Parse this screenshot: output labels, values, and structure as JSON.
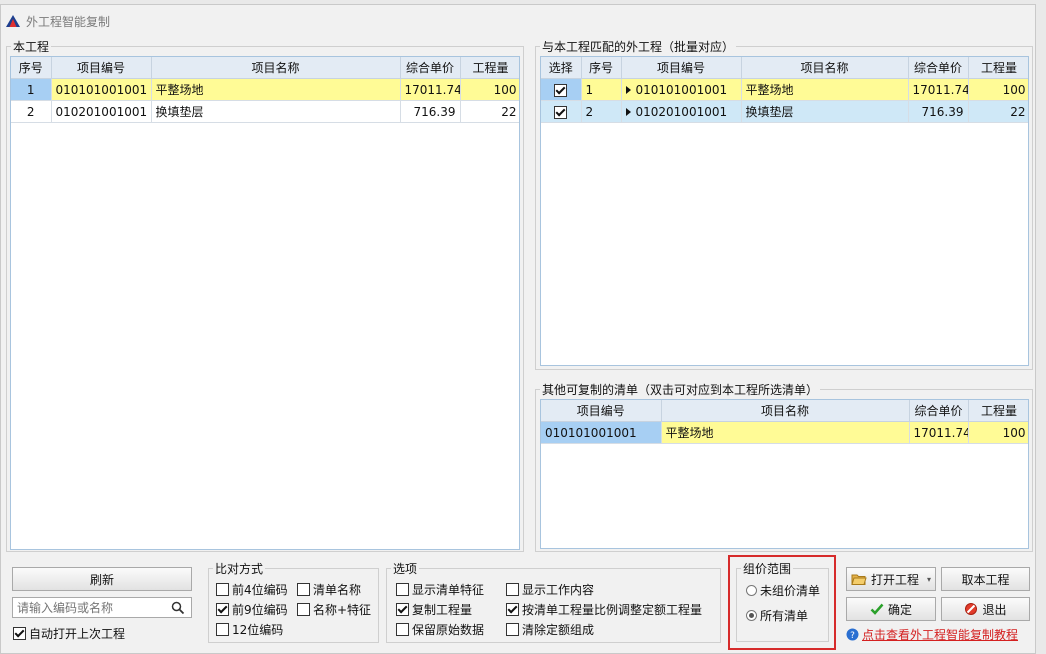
{
  "window": {
    "title": "外工程智能复制"
  },
  "left_panel": {
    "title": "本工程",
    "columns": [
      "序号",
      "项目编号",
      "项目名称",
      "综合单价",
      "工程量"
    ],
    "rows": [
      {
        "idx": "1",
        "code": "010101001001",
        "name": "平整场地",
        "price": "17011.74",
        "qty": "100"
      },
      {
        "idx": "2",
        "code": "010201001001",
        "name": "换填垫层",
        "price": "716.39",
        "qty": "22"
      }
    ]
  },
  "match_panel": {
    "title": "与本工程匹配的外工程（批量对应）",
    "columns": [
      "选择",
      "序号",
      "项目编号",
      "项目名称",
      "综合单价",
      "工程量"
    ],
    "rows": [
      {
        "checked": true,
        "idx": "1",
        "code": "010101001001",
        "name": "平整场地",
        "price": "17011.74",
        "qty": "100"
      },
      {
        "checked": true,
        "idx": "2",
        "code": "010201001001",
        "name": "换填垫层",
        "price": "716.39",
        "qty": "22"
      }
    ]
  },
  "other_panel": {
    "title": "其他可复制的清单（双击可对应到本工程所选清单）",
    "columns": [
      "项目编号",
      "项目名称",
      "综合单价",
      "工程量"
    ],
    "rows": [
      {
        "code": "010101001001",
        "name": "平整场地",
        "price": "17011.74",
        "qty": "100"
      }
    ]
  },
  "bottom": {
    "refresh_label": "刷新",
    "search_placeholder": "请输入编码或名称",
    "auto_open_label": "自动打开上次工程",
    "compare": {
      "title": "比对方式",
      "prefix4": "前4位编码",
      "prefix9": "前9位编码",
      "code12": "12位编码",
      "list_name": "清单名称",
      "name_feature": "名称+特征"
    },
    "options": {
      "title": "选项",
      "show_feature": "显示清单特征",
      "copy_qty": "复制工程量",
      "keep_original": "保留原始数据",
      "show_work": "显示工作内容",
      "adjust_quota": "按清单工程量比例调整定额工程量",
      "clear_quota": "清除定额组成"
    },
    "range": {
      "title": "组价范围",
      "unpriced": "未组价清单",
      "all": "所有清单"
    },
    "buttons": {
      "open_project": "打开工程",
      "take_project": "取本工程",
      "confirm": "确定",
      "exit": "退出"
    },
    "help_link": "点击查看外工程智能复制教程"
  },
  "colors": {
    "highlight_row": "#fffb96",
    "selected_idx": "#a7cff3",
    "alt_row": "#cfe8f7",
    "red_box": "#d62b2b"
  }
}
